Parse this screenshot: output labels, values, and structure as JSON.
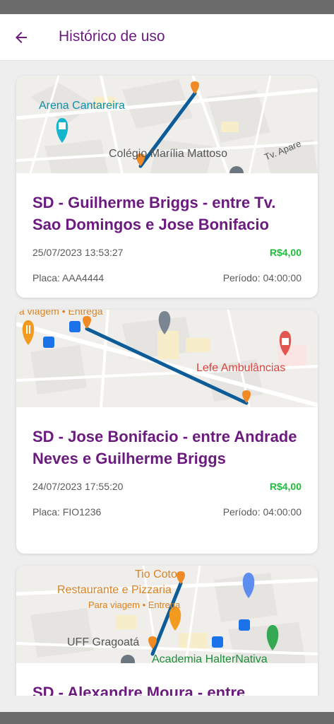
{
  "header": {
    "title": "Histórico de uso"
  },
  "cards": [
    {
      "title": "SD - Guilherme Briggs - entre Tv. Sao Domingos e Jose Bonifacio",
      "datetime": "25/07/2023 13:53:27",
      "price": "R$4,00",
      "plate": "Placa: AAA4444",
      "period": "Período: 04:00:00",
      "map_labels": [
        "Arena Cantareira",
        "Colégio Marília Mattoso",
        "Tv. Apare"
      ]
    },
    {
      "title": "SD - Jose Bonifacio - entre Andrade Neves e Guilherme Briggs",
      "datetime": "24/07/2023 17:55:20",
      "price": "R$4,00",
      "plate": "Placa: FIO1236",
      "period": "Período: 04:00:00",
      "map_labels": [
        "a viagem • Entrega",
        "Lefe Ambulâncias"
      ]
    },
    {
      "title": "SD - Alexandre Moura - entre",
      "map_labels": [
        "Tio Coto -",
        "Restaurante e Pizzaria",
        "Para viagem • Entrega",
        "UFF Gragoatá",
        "Academia HalterNativa"
      ]
    }
  ],
  "colors": {
    "accent": "#6a1b7d",
    "price": "#1fbd3a",
    "route": "#0b5c99",
    "pin": "#f08a24"
  },
  "icons": [
    "back-arrow-icon",
    "map-pin-icon",
    "landmark-icon",
    "restaurant-icon",
    "bus-stop-icon",
    "hospital-icon",
    "education-icon",
    "shopping-icon"
  ]
}
